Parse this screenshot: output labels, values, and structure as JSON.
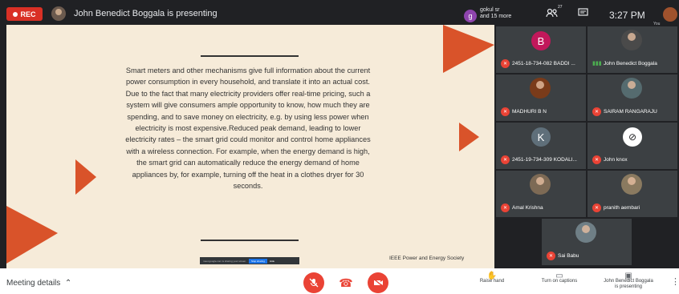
{
  "topbar": {
    "rec_label": "REC",
    "title": "John Benedict Boggala is presenting",
    "guest_initial": "g",
    "guest_name": "gokul sr",
    "guest_more": "and 15 more",
    "people_count": "27",
    "time": "3:27 PM",
    "you_label": "You"
  },
  "slide": {
    "body": "Smart meters and other mechanisms give full information about the current power consumption in every household, and translate it into an actual cost. Due to the fact that many electricity providers offer real-time pricing, such a system will give consumers ample opportunity to know, how much they are spending, and to save money on electricity, e.g. by using less power when electricity is most expensive.Reduced peak demand, leading to lower electricity rates – the smart grid could monitor and control home appliances with a wireless connection. For example, when the energy demand is high, the smart grid can automatically reduce the energy demand of home appliances by, for example, turning off the heat in a clothes dryer for 30 seconds.",
    "footer": "IEEE Power and Energy Society",
    "share_text": "meet.google.com is sharing your screen.",
    "share_stop": "Stop sharing",
    "share_hide": "Hide",
    "accent_color": "#d9532a"
  },
  "participants": [
    {
      "name": "2451-18-734-082 BADDI ...",
      "initial": "B",
      "color": "#c2185b",
      "muted": true
    },
    {
      "name": "John Benedict Boggala",
      "initial": "",
      "color": "#4a4a4a",
      "muted": false
    },
    {
      "name": "MADHURI B N",
      "initial": "",
      "color": "#7a3b1a",
      "muted": true
    },
    {
      "name": "SAIRAM RANGARAJU",
      "initial": "",
      "color": "#556b6f",
      "muted": true
    },
    {
      "name": "2451-19-734-309 KODALI...",
      "initial": "K",
      "color": "#5f6f7a",
      "muted": true
    },
    {
      "name": "John knox",
      "initial": "",
      "color": "#ffffff",
      "muted": true
    },
    {
      "name": "Amal Krishna",
      "initial": "",
      "color": "#7d6a55",
      "muted": true
    },
    {
      "name": "pranith aembari",
      "initial": "",
      "color": "#8a7a60",
      "muted": true
    },
    {
      "name": "Sai Babu",
      "initial": "",
      "color": "#6f7f86",
      "muted": true
    }
  ],
  "bottombar": {
    "meeting_details": "Meeting details",
    "raise_hand": "Raise hand",
    "captions": "Turn on captions",
    "presenting_line1": "John Benedict Boggala",
    "presenting_line2": "is presenting"
  }
}
